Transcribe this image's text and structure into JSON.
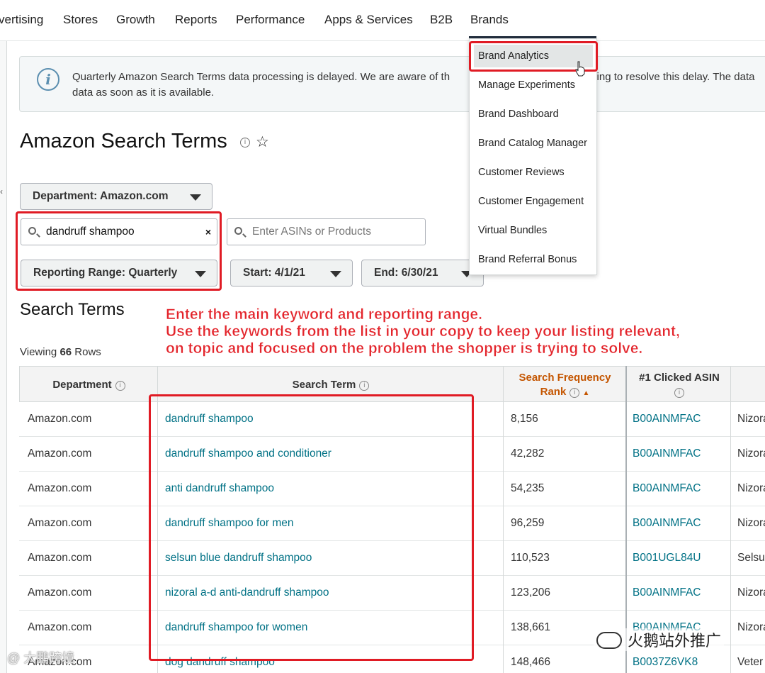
{
  "nav": {
    "items": [
      "vertising",
      "Stores",
      "Growth",
      "Reports",
      "Performance",
      "Apps & Services",
      "B2B",
      "Brands"
    ]
  },
  "banner": {
    "message_line1": "Quarterly Amazon Search Terms data processing is delayed. We are aware of th",
    "message_line1_right": "king to resolve this delay. The data",
    "message_line2": "data as soon as it is available."
  },
  "page": {
    "title": "Amazon Search Terms",
    "info_glyph": "i",
    "star_glyph": "☆"
  },
  "filters": {
    "department": "Department: Amazon.com",
    "search_value": "dandruff shampoo",
    "clear_glyph": "×",
    "asin_placeholder": "Enter ASINs or Products",
    "reporting_range": "Reporting Range: Quarterly",
    "start": "Start: 4/1/21",
    "end": "End: 6/30/21"
  },
  "annotation": {
    "line1": "Enter the main keyword and reporting range.",
    "line2": "Use the keywords from the list in your copy to keep your listing relevant,",
    "line3": "on topic and focused on the problem the shopper is trying to solve."
  },
  "section": {
    "title": "Search Terms",
    "viewing_prefix": "Viewing",
    "row_count": "66",
    "viewing_suffix": "Rows"
  },
  "table": {
    "headers": {
      "department": "Department",
      "search_term": "Search Term",
      "sfr_line1": "Search Frequency",
      "sfr_line2": "Rank",
      "sort_glyph": "▲",
      "clicked_asin": "#1 Clicked ASIN"
    },
    "rows": [
      {
        "department": "Amazon.com",
        "term": "dandruff shampoo",
        "rank": "8,156",
        "asin": "B00AINMFAC",
        "brand": "Nizora"
      },
      {
        "department": "Amazon.com",
        "term": "dandruff shampoo and conditioner",
        "rank": "42,282",
        "asin": "B00AINMFAC",
        "brand": "Nizora"
      },
      {
        "department": "Amazon.com",
        "term": "anti dandruff shampoo",
        "rank": "54,235",
        "asin": "B00AINMFAC",
        "brand": "Nizora"
      },
      {
        "department": "Amazon.com",
        "term": "dandruff shampoo for men",
        "rank": "96,259",
        "asin": "B00AINMFAC",
        "brand": "Nizora"
      },
      {
        "department": "Amazon.com",
        "term": "selsun blue dandruff shampoo",
        "rank": "110,523",
        "asin": "B001UGL84U",
        "brand": "Selsu"
      },
      {
        "department": "Amazon.com",
        "term": "nizoral a-d anti-dandruff shampoo",
        "rank": "123,206",
        "asin": "B00AINMFAC",
        "brand": "Nizora"
      },
      {
        "department": "Amazon.com",
        "term": "dandruff shampoo for women",
        "rank": "138,661",
        "asin": "B00AINMFAC",
        "brand": "Nizora"
      },
      {
        "department": "Amazon.com",
        "term": "dog dandruff shampoo",
        "rank": "148,466",
        "asin": "B0037Z6VK8",
        "brand": "Veter"
      }
    ]
  },
  "brands_menu": {
    "items": [
      "Brand Analytics",
      "Manage Experiments",
      "Brand Dashboard",
      "Brand Catalog Manager",
      "Customer Reviews",
      "Customer Engagement",
      "Virtual Bundles",
      "Brand Referral Bonus"
    ]
  },
  "watermarks": {
    "left": "@ 大鹏跨境",
    "right": "火鹅站外推广"
  },
  "colors": {
    "link": "#007185",
    "annotation_red": "#e01b24",
    "sort_orange": "#c45500"
  }
}
